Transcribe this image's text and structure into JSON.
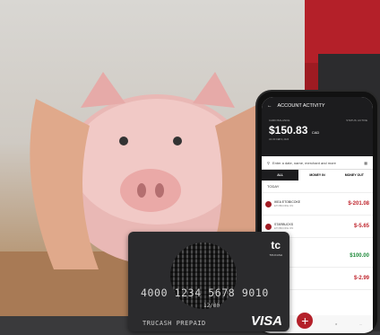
{
  "phone": {
    "title": "ACCOUNT ACTIVITY",
    "balance_label": "CARD BALANCE",
    "balance_amount": "$150.83",
    "balance_currency": "CAD",
    "balance_date": "AS OF FEB 9, 2023",
    "status_label": "STATUS: ACTIVE",
    "search_placeholder": "Enter a date, name, merchant and more",
    "tabs": [
      "ALL",
      "MONEY IN",
      "MONEY OUT"
    ],
    "section_today": "TODAY",
    "transactions": [
      {
        "name": "IKEA ETOBICOKE",
        "sub": "ETOBICOKE ON",
        "amount": "$-201.08",
        "type": "neg"
      },
      {
        "name": "STARBUCKS",
        "sub": "ETOBICOKE ON",
        "amount": "$-5.65",
        "type": "neg"
      },
      {
        "name": "/ TruCash",
        "sub": "e Request",
        "amount": "$100.00",
        "type": "pos"
      },
      {
        "name": "M Withdrawl",
        "sub": "RONTO ON",
        "amount": "$-2.99",
        "type": "neg"
      }
    ],
    "plus_label": "+"
  },
  "card": {
    "logo": "tc",
    "logo_sub": "TRUCASH",
    "number": "4000 1234 5678 9010",
    "valid": "12/00",
    "name": "TRUCASH PREPAID",
    "brand": "VISA"
  },
  "colors": {
    "accent": "#b42029",
    "dark": "#1c1c1e"
  }
}
